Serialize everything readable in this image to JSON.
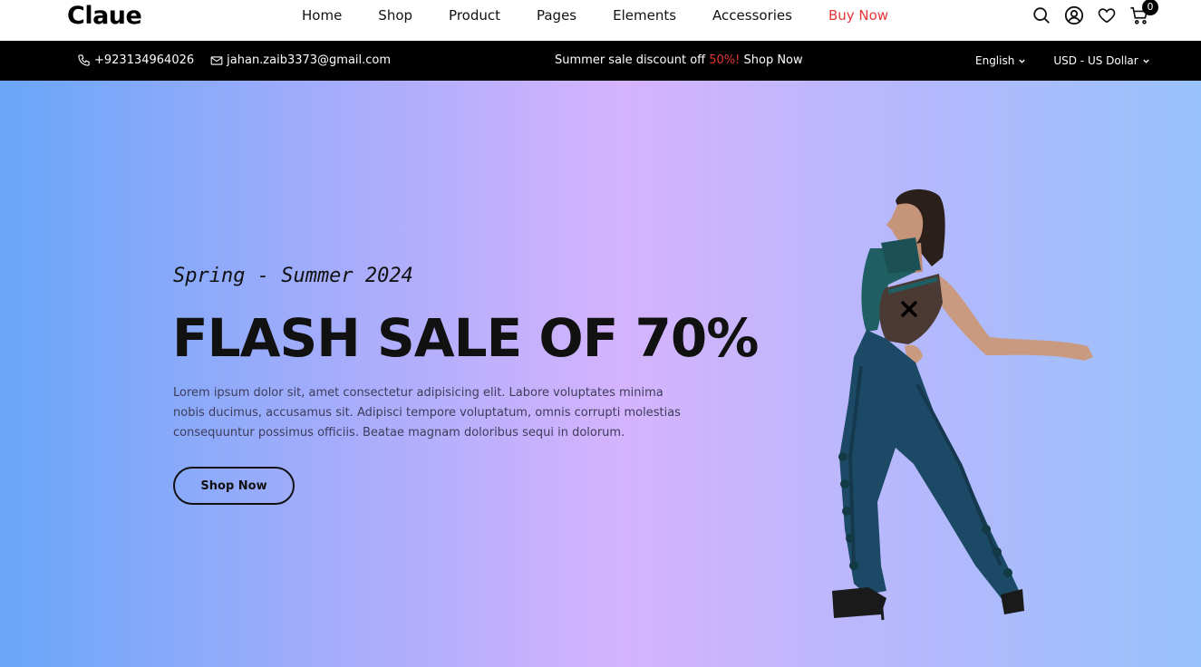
{
  "header": {
    "logo": "Claue",
    "nav": [
      "Home",
      "Shop",
      "Product",
      "Pages",
      "Elements",
      "Accessories",
      "Buy Now"
    ],
    "cart_count": "0",
    "accent_color": "#e53637"
  },
  "topbar": {
    "phone": "+923134964026",
    "email": "jahan.zaib3373@gmail.com",
    "promo_prefix": "Summer sale discount off ",
    "promo_highlight": "50%!",
    "promo_link": " Shop Now",
    "language": "English",
    "currency": "USD - US Dollar"
  },
  "hero": {
    "kicker": "Spring - Summer 2024",
    "headline": "FLASH SALE OF 70%",
    "description": "Lorem ipsum dolor sit, amet consectetur adipisicing elit. Labore voluptates minima nobis ducimus, accusamus sit. Adipisci tempore voluptatum, omnis corrupti molestias consequuntur possimus officiis. Beatae magnam doloribus sequi in dolorum.",
    "cta": "Shop Now"
  },
  "icons": [
    "search-icon",
    "user-icon",
    "heart-icon",
    "cart-icon",
    "phone-icon",
    "mail-icon",
    "chevron-down-icon",
    "close-icon"
  ]
}
